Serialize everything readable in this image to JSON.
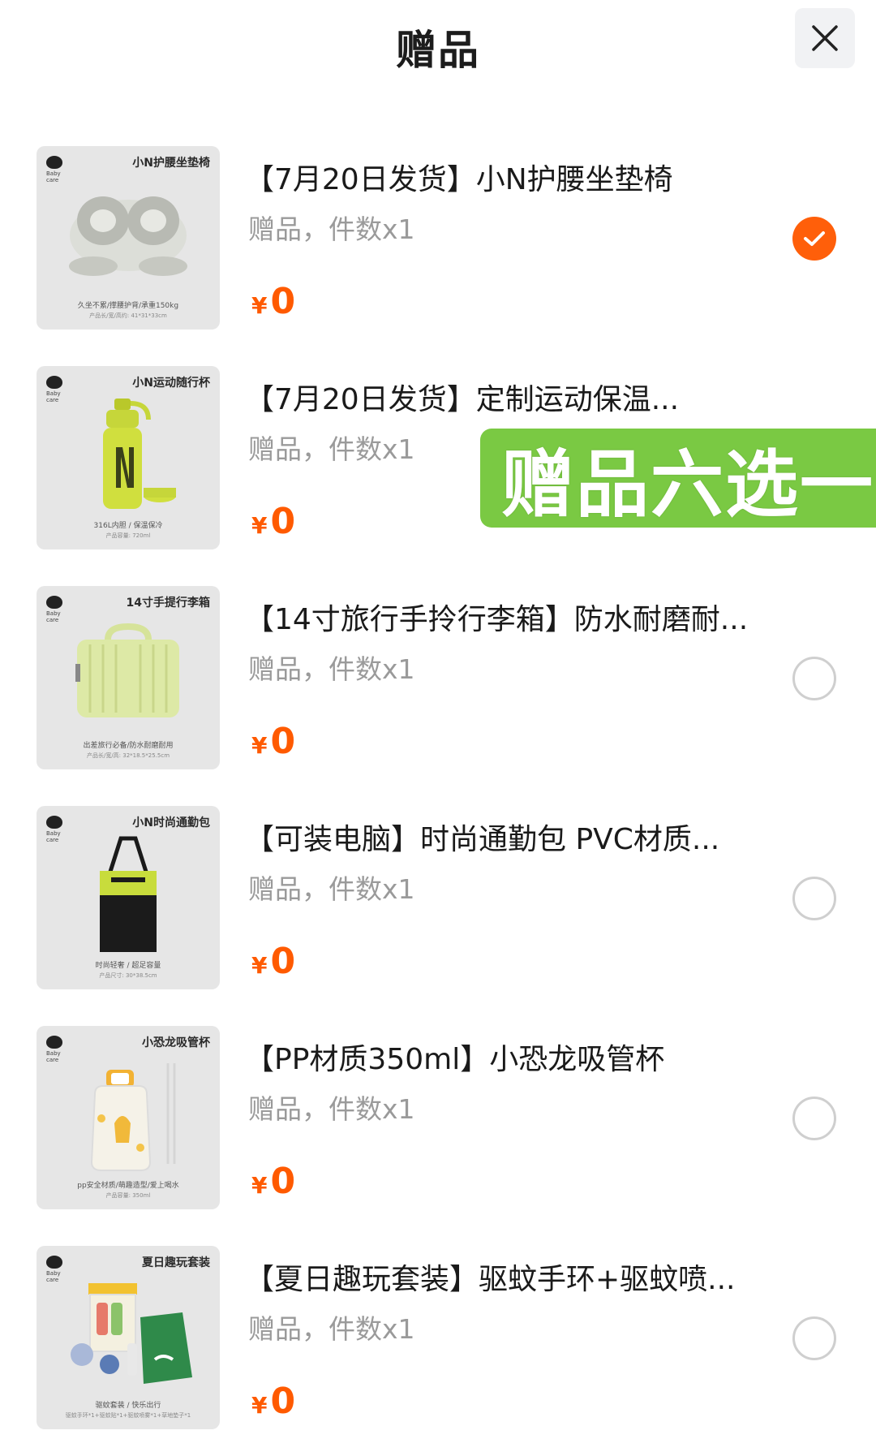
{
  "header": {
    "title": "赠品",
    "close_icon": "close-icon"
  },
  "colors": {
    "accent": "#ff5a00",
    "banner": "#7ac943",
    "muted_text": "#9a9a9a"
  },
  "items": [
    {
      "name": "【7月20日发货】小N护腰坐垫椅",
      "meta": "赠品，件数x1",
      "currency": "¥",
      "price": "0",
      "selected": true,
      "thumb": {
        "brand": "Baby care",
        "label": "小N护腰坐垫椅",
        "caption": "久坐不累/撑腰护背/承重150kg",
        "sub": "产品长/宽/高约: 41*31*33cm",
        "icon": "cushion-chair-icon"
      }
    },
    {
      "name": "【7月20日发货】定制运动保温...",
      "meta": "赠品，件数x1",
      "currency": "¥",
      "price": "0",
      "selected": false,
      "thumb": {
        "brand": "Baby care",
        "label": "小N运动随行杯",
        "caption": "316L内胆 / 保温保冷",
        "sub": "产品容量: 720ml",
        "icon": "water-bottle-icon"
      }
    },
    {
      "name": "【14寸旅行手拎行李箱】防水耐磨耐...",
      "meta": "赠品，件数x1",
      "currency": "¥",
      "price": "0",
      "selected": false,
      "thumb": {
        "brand": "Baby care",
        "label": "14寸手提行李箱",
        "caption": "出差旅行必备/防水耐磨耐用",
        "sub": "产品长/宽/高: 32*18.5*25.5cm",
        "icon": "suitcase-icon"
      }
    },
    {
      "name": "【可装电脑】时尚通勤包 PVC材质...",
      "meta": "赠品，件数x1",
      "currency": "¥",
      "price": "0",
      "selected": false,
      "thumb": {
        "brand": "Baby care",
        "label": "小N时尚通勤包",
        "caption": "时尚轻奢 / 超足容量",
        "sub": "产品尺寸: 30*38.5cm",
        "icon": "tote-bag-icon"
      }
    },
    {
      "name": "【PP材质350ml】小恐龙吸管杯",
      "meta": "赠品，件数x1",
      "currency": "¥",
      "price": "0",
      "selected": false,
      "thumb": {
        "brand": "Baby care",
        "label": "小恐龙吸管杯",
        "caption": "pp安全材质/萌趣造型/爱上喝水",
        "sub": "产品容量: 350ml",
        "icon": "straw-cup-icon"
      }
    },
    {
      "name": "【夏日趣玩套装】驱蚊手环+驱蚊喷...",
      "meta": "赠品，件数x1",
      "currency": "¥",
      "price": "0",
      "selected": false,
      "thumb": {
        "brand": "Baby care",
        "label": "夏日趣玩套装",
        "caption": "驱蚊套装 / 快乐出行",
        "sub": "驱蚊手环*1+驱蚊贴*1+驱蚊喷雾*1+草地垫子*1",
        "icon": "summer-kit-icon"
      }
    }
  ],
  "promo_banner": {
    "text": "赠品六选一"
  }
}
